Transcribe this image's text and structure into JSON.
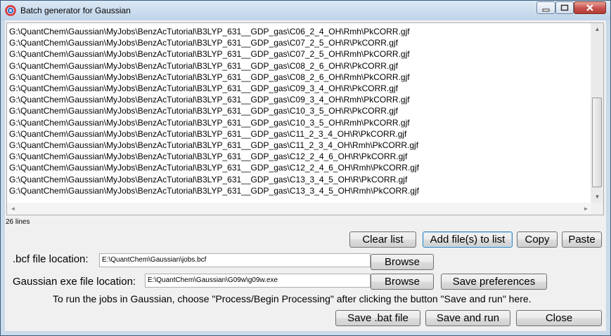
{
  "window": {
    "title": "Batch generator for Gaussian"
  },
  "file_list": {
    "lines": [
      "G:\\QuantChem\\Gaussian\\MyJobs\\BenzAcTutorial\\B3LYP_631__GDP_gas\\C06_2_4_OH\\Rmh\\PkCORR.gjf",
      "G:\\QuantChem\\Gaussian\\MyJobs\\BenzAcTutorial\\B3LYP_631__GDP_gas\\C07_2_5_OH\\R\\PkCORR.gjf",
      "G:\\QuantChem\\Gaussian\\MyJobs\\BenzAcTutorial\\B3LYP_631__GDP_gas\\C07_2_5_OH\\Rmh\\PkCORR.gjf",
      "G:\\QuantChem\\Gaussian\\MyJobs\\BenzAcTutorial\\B3LYP_631__GDP_gas\\C08_2_6_OH\\R\\PkCORR.gjf",
      "G:\\QuantChem\\Gaussian\\MyJobs\\BenzAcTutorial\\B3LYP_631__GDP_gas\\C08_2_6_OH\\Rmh\\PkCORR.gjf",
      "G:\\QuantChem\\Gaussian\\MyJobs\\BenzAcTutorial\\B3LYP_631__GDP_gas\\C09_3_4_OH\\R\\PkCORR.gjf",
      "G:\\QuantChem\\Gaussian\\MyJobs\\BenzAcTutorial\\B3LYP_631__GDP_gas\\C09_3_4_OH\\Rmh\\PkCORR.gjf",
      "G:\\QuantChem\\Gaussian\\MyJobs\\BenzAcTutorial\\B3LYP_631__GDP_gas\\C10_3_5_OH\\R\\PkCORR.gjf",
      "G:\\QuantChem\\Gaussian\\MyJobs\\BenzAcTutorial\\B3LYP_631__GDP_gas\\C10_3_5_OH\\Rmh\\PkCORR.gjf",
      "G:\\QuantChem\\Gaussian\\MyJobs\\BenzAcTutorial\\B3LYP_631__GDP_gas\\C11_2_3_4_OH\\R\\PkCORR.gjf",
      "G:\\QuantChem\\Gaussian\\MyJobs\\BenzAcTutorial\\B3LYP_631__GDP_gas\\C11_2_3_4_OH\\Rmh\\PkCORR.gjf",
      "G:\\QuantChem\\Gaussian\\MyJobs\\BenzAcTutorial\\B3LYP_631__GDP_gas\\C12_2_4_6_OH\\R\\PkCORR.gjf",
      "G:\\QuantChem\\Gaussian\\MyJobs\\BenzAcTutorial\\B3LYP_631__GDP_gas\\C12_2_4_6_OH\\Rmh\\PkCORR.gjf",
      "G:\\QuantChem\\Gaussian\\MyJobs\\BenzAcTutorial\\B3LYP_631__GDP_gas\\C13_3_4_5_OH\\R\\PkCORR.gjf",
      "G:\\QuantChem\\Gaussian\\MyJobs\\BenzAcTutorial\\B3LYP_631__GDP_gas\\C13_3_4_5_OH\\Rmh\\PkCORR.gjf"
    ],
    "line_count": "26 lines"
  },
  "list_buttons": {
    "clear": "Clear list",
    "add": "Add file(s) to list",
    "copy": "Copy",
    "paste": "Paste"
  },
  "bcf": {
    "label": ".bcf file location:",
    "value": "E:\\QuantChem\\Gaussian\\jobs.bcf",
    "browse": "Browse"
  },
  "exe": {
    "label": "Gaussian exe file location:",
    "value": "E:\\QuantChem\\Gaussian\\G09w\\g09w.exe",
    "browse": "Browse",
    "save_prefs": "Save preferences"
  },
  "hint": "To run the jobs in Gaussian, choose \"Process/Begin Processing\" after clicking the button \"Save and run\" here.",
  "actions": {
    "save_bat": "Save .bat file",
    "save_run": "Save and run",
    "close": "Close"
  },
  "icons": {
    "app": "gaussian-app-icon",
    "minimize": "minimize-icon",
    "maximize": "maximize-icon",
    "close": "close-icon"
  }
}
